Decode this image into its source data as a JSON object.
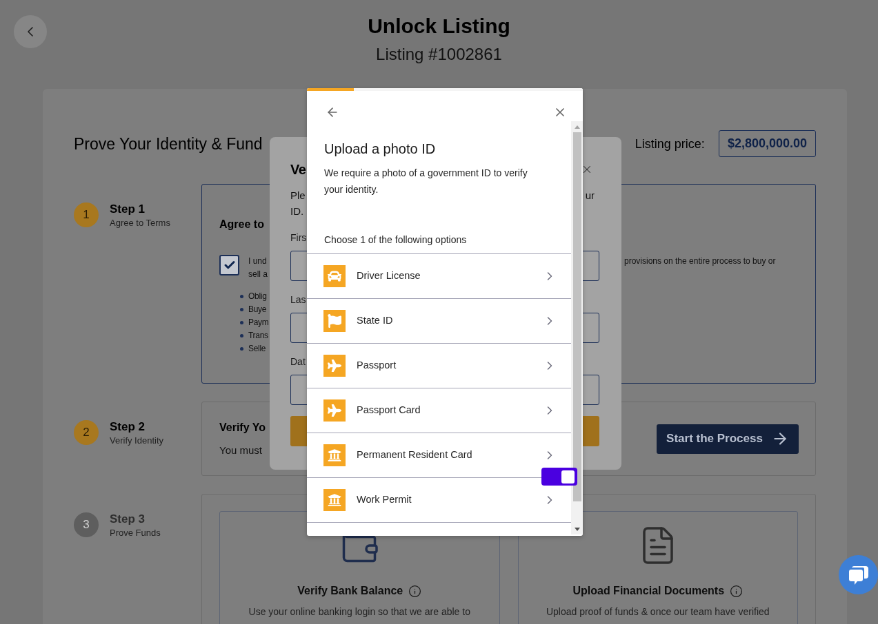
{
  "header": {
    "title": "Unlock Listing",
    "subtitle": "Listing #1002861"
  },
  "identity_section": {
    "heading": "Prove Your Identity & Fund",
    "price_label": "Listing price:",
    "price": "$2,800,000.00"
  },
  "steps": [
    {
      "number": "1",
      "title": "Step 1",
      "caption": "Agree to Terms",
      "enabled": true
    },
    {
      "number": "2",
      "title": "Step 2",
      "caption": "Verify Identity",
      "enabled": true
    },
    {
      "number": "3",
      "title": "Step 3",
      "caption": "Prove Funds",
      "enabled": false
    }
  ],
  "terms_card": {
    "heading": "Agree to",
    "checked": true,
    "statement_lines": [
      "I und",
      "sell a"
    ],
    "statement_continuation": "provisions on the entire process to buy or",
    "bullets": [
      "Oblig",
      "Buye",
      "Paym",
      "Trans",
      "Selle"
    ]
  },
  "verify_card": {
    "heading": "Verify Yo",
    "text": "You must",
    "button": "Start the Process"
  },
  "funds_card": {
    "options": [
      {
        "title": "Verify Bank Balance",
        "text": "Use your online banking login so that we are able to"
      },
      {
        "title": "Upload Financial Documents",
        "text": "Upload proof of funds & once our team have verified"
      }
    ]
  },
  "verify_dialog": {
    "title": "Ve",
    "intro_lines": [
      "Ple",
      "ID."
    ],
    "intro_right": "ur",
    "fields": [
      {
        "label": "Firs"
      },
      {
        "label": "Las"
      },
      {
        "label": "Dat"
      }
    ]
  },
  "photo_id_dialog": {
    "progress": {
      "level": 0.17
    },
    "title": "Upload a photo ID",
    "description": "We require a photo of a government ID to verify your identity.",
    "prompt": "Choose 1 of the following options",
    "options": [
      {
        "label": "Driver License"
      },
      {
        "label": "State ID"
      },
      {
        "label": "Passport"
      },
      {
        "label": "Passport Card"
      },
      {
        "label": "Permanent Resident Card"
      },
      {
        "label": "Work Permit"
      }
    ]
  },
  "floating_switch": {
    "on": true
  }
}
